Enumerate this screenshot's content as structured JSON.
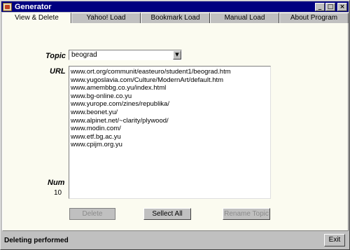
{
  "window": {
    "title": "Generator",
    "controls": {
      "minimize": "_",
      "maximize": "□",
      "close": "×"
    }
  },
  "tabs": [
    {
      "label": "View & Delete",
      "active": true
    },
    {
      "label": "Yahoo! Load",
      "active": false
    },
    {
      "label": "Bookmark Load",
      "active": false
    },
    {
      "label": "Manual Load",
      "active": false
    },
    {
      "label": "About Program",
      "active": false
    }
  ],
  "form": {
    "topic_label": "Topic",
    "topic_value": "beograd",
    "url_label": "URL",
    "urls": [
      "www.ort.org/communit/easteuro/student1/beograd.htm",
      "www.yugoslavia.com/Culture/ModernArt/default.htm",
      "www.amembbg.co.yu/index.html",
      "www.bg-online.co.yu",
      "www.yurope.com/zines/republika/",
      "www.beonet.yu/",
      "www.alpinet.net/~clarity/plywood/",
      "www.modin.com/",
      "www.etf.bg.ac.yu",
      "www.cpijm.org.yu"
    ],
    "num_label": "Num",
    "num_value": "10"
  },
  "buttons": {
    "delete": "Delete",
    "select_all": "Sellect All",
    "rename_topic": "Rename Topic",
    "exit": "Exit"
  },
  "status": {
    "text": "Deleting performed"
  },
  "colors": {
    "titlebar": "#000080",
    "panel_bg": "#fbfbf0",
    "chrome": "#c0c0c0"
  }
}
